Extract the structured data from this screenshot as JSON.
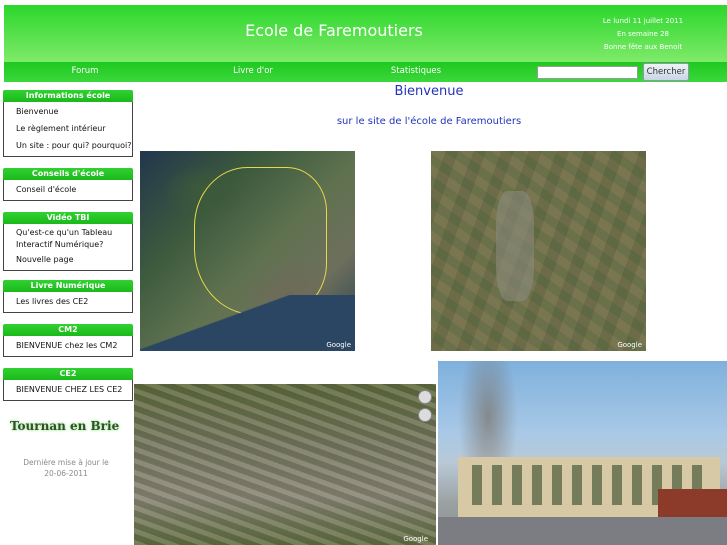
{
  "header": {
    "title": "Ecole de Faremoutiers",
    "date_line": "Le lundi 11 juillet 2011",
    "week_line": "En semaine 28",
    "saint_line": "Bonne fête aux Benoit"
  },
  "nav": {
    "items": [
      "Forum",
      "Livre d'or",
      "Statistiques"
    ],
    "search_value": "",
    "search_button": "Chercher"
  },
  "sidebar": {
    "boxes": [
      {
        "title": "Informations école",
        "items": [
          "Bienvenue",
          "Le règlement intérieur",
          "Un site : pour qui? pourquoi?"
        ]
      },
      {
        "title": "Conseils d'école",
        "items": [
          "Conseil d'école"
        ]
      },
      {
        "title": "Vidéo TBI",
        "items": [
          "Qu'est-ce qu'un Tableau",
          "Interactif Numérique?",
          "Nouvelle page"
        ]
      },
      {
        "title": "Livre Numérique",
        "items": [
          "Les livres des CE2"
        ]
      },
      {
        "title": "CM2",
        "items": [
          "BIENVENUE chez les CM2"
        ]
      },
      {
        "title": "CE2",
        "items": [
          "BIENVENUE CHEZ LES CE2"
        ]
      }
    ],
    "tournan": "Tournan en Brie",
    "update_line1": "Dernière mise à jour le",
    "update_line2": "20-06-2011"
  },
  "main": {
    "welcome": "Bienvenue",
    "subtitle": "sur le site de l'école de Faremoutiers",
    "google_label": "Google"
  }
}
